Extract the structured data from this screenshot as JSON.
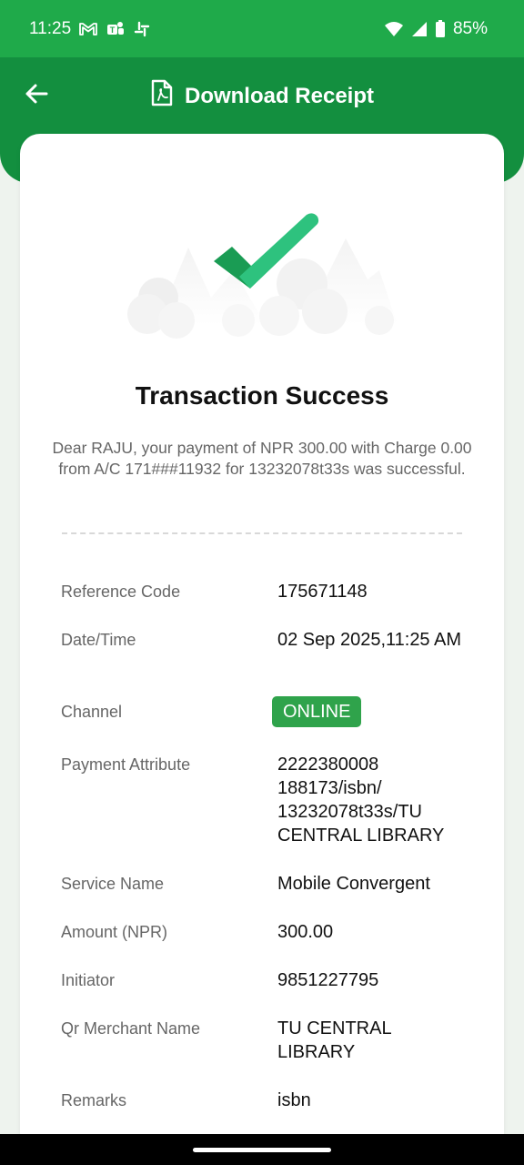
{
  "status_bar": {
    "time": "11:25",
    "battery": "85%",
    "icons": [
      "gmail-icon",
      "teams-icon",
      "slack-icon",
      "wifi-icon",
      "signal-icon",
      "battery-icon"
    ]
  },
  "header": {
    "title": "Download Receipt",
    "back_icon": "arrow-left-icon",
    "title_icon": "pdf-file-icon"
  },
  "receipt": {
    "title": "Transaction Success",
    "message": "Dear RAJU, your payment of NPR 300.00 with Charge 0.00 from A/C 171###11932 for 13232078t33s was successful.",
    "details": [
      {
        "label": "Reference Code",
        "value": "175671148"
      },
      {
        "label": "Date/Time",
        "value": "02 Sep 2025,11:25 AM"
      },
      {
        "label": "Channel",
        "value": "ONLINE"
      },
      {
        "label": "Payment Attribute",
        "value": "2222380008 188173/isbn/ 13232078t33s/TU CENTRAL LIBRARY"
      },
      {
        "label": "Service Name",
        "value": "Mobile Convergent"
      },
      {
        "label": "Amount (NPR)",
        "value": "300.00"
      },
      {
        "label": "Initiator",
        "value": "9851227795"
      },
      {
        "label": "Qr Merchant Name",
        "value": "TU CENTRAL LIBRARY"
      },
      {
        "label": "Remarks",
        "value": "isbn"
      }
    ]
  },
  "colors": {
    "status_bar": "#1faa4a",
    "header": "#138f3f",
    "badge": "#2fa34b",
    "check_dark": "#1a9c54",
    "check_light": "#2ec27e"
  }
}
